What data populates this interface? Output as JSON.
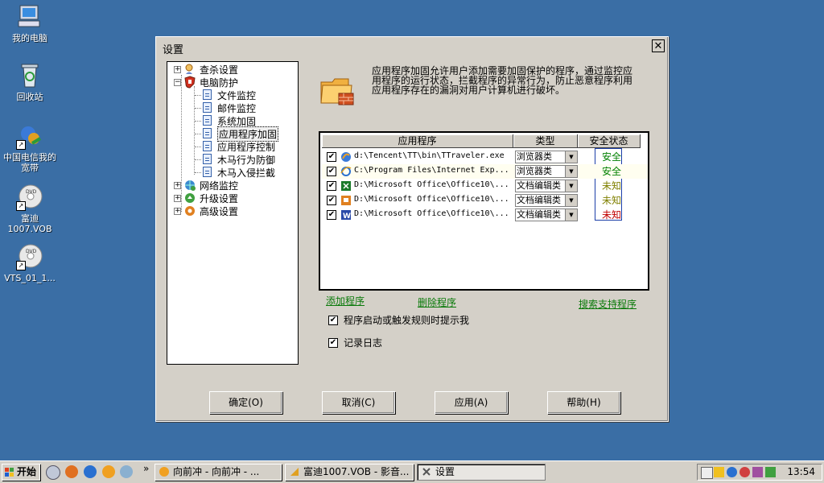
{
  "desktop": {
    "icons": [
      {
        "label": "我的电脑",
        "icon": "my-computer-icon"
      },
      {
        "label": "回收站",
        "icon": "recycle-bin-icon"
      },
      {
        "label": "中国电信我的宽带",
        "icon": "china-telecom-broadband-icon"
      },
      {
        "label": "富迪\n1007.VOB",
        "icon": "dvd-icon"
      },
      {
        "label": "VTS_01_1...",
        "icon": "dvd-icon"
      }
    ]
  },
  "dialog": {
    "title": "设置",
    "close": "✕",
    "tree": [
      {
        "label": "查杀设置",
        "expander": "+",
        "icon": "scan-icon"
      },
      {
        "label": "电脑防护",
        "expander": "−",
        "icon": "shield-icon"
      },
      {
        "label": "文件监控",
        "icon": "doc-icon"
      },
      {
        "label": "邮件监控",
        "icon": "doc-icon"
      },
      {
        "label": "系统加固",
        "icon": "doc-icon"
      },
      {
        "label": "应用程序加固",
        "icon": "doc-icon",
        "selected": true
      },
      {
        "label": "应用程序控制",
        "icon": "doc-icon"
      },
      {
        "label": "木马行为防御",
        "icon": "doc-icon"
      },
      {
        "label": "木马入侵拦截",
        "icon": "doc-icon"
      },
      {
        "label": "网络监控",
        "expander": "+",
        "icon": "network-icon"
      },
      {
        "label": "升级设置",
        "expander": "+",
        "icon": "update-icon"
      },
      {
        "label": "高级设置",
        "expander": "+",
        "icon": "advanced-icon"
      }
    ],
    "description": "应用程序加固允许用户添加需要加固保护的程序，通过监控应用程序的运行状态，拦截程序的异常行为，防止恶意程序利用应用程序存在的漏洞对用户计算机进行破坏。",
    "table": {
      "headers": [
        "应用程序",
        "类型",
        "安全状态"
      ],
      "rows": [
        {
          "checked": "✔",
          "icon": "tt-browser-icon",
          "path": "d:\\Tencent\\TT\\bin\\TTraveler.exe",
          "type": "浏览器类",
          "status": "安全",
          "status_kind": "safe"
        },
        {
          "checked": "✔",
          "icon": "ie-icon",
          "path": "C:\\Program Files\\Internet Exp...",
          "type": "浏览器类",
          "status": "安全",
          "status_kind": "safe"
        },
        {
          "checked": "✔",
          "icon": "excel-icon",
          "path": "D:\\Microsoft Office\\Office10\\...",
          "type": "文档编辑类",
          "status": "未知",
          "status_kind": "unknown"
        },
        {
          "checked": "✔",
          "icon": "powerpoint-icon",
          "path": "D:\\Microsoft Office\\Office10\\...",
          "type": "文档编辑类",
          "status": "未知",
          "status_kind": "unknown"
        },
        {
          "checked": "✔",
          "icon": "word-icon",
          "path": "D:\\Microsoft Office\\Office10\\...",
          "type": "文档编辑类",
          "status": "未知",
          "status_kind": "red"
        }
      ]
    },
    "links": {
      "add": "添加程序",
      "delete": "删除程序",
      "search": "搜索支持程序"
    },
    "options": [
      {
        "checked": "✔",
        "label": "程序启动或触发规则时提示我"
      },
      {
        "checked": "✔",
        "label": "记录日志"
      }
    ],
    "buttons": {
      "ok": "确定(O)",
      "cancel": "取消(C)",
      "apply": "应用(A)",
      "help": "帮助(H)"
    }
  },
  "taskbar": {
    "start": "开始",
    "chevron": "»",
    "tasks": [
      {
        "label": "向前冲 - 向前冲 - ...",
        "icon": "media-icon"
      },
      {
        "label": "富迪1007.VOB - 影音...",
        "icon": "player-icon"
      },
      {
        "label": "设置",
        "icon": "settings-icon",
        "active": true
      }
    ],
    "clock": "13:54"
  },
  "colors": {
    "desktop": "#3a6ea5",
    "face": "#d4d0c8",
    "link": "#0a7a0a",
    "safe": "#008000",
    "unknown": "#808000",
    "danger": "#c00000"
  }
}
